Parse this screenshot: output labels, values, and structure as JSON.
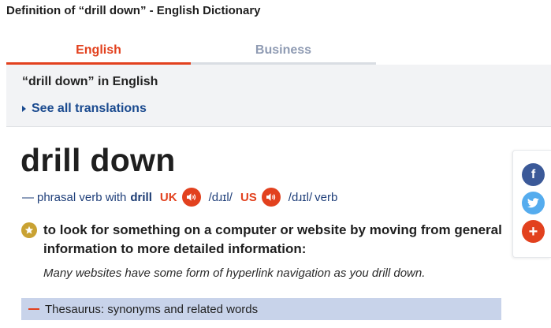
{
  "page": {
    "title": "Definition of “drill down” - English Dictionary"
  },
  "tabs": [
    {
      "label": "English",
      "active": true
    },
    {
      "label": "Business",
      "active": false
    }
  ],
  "translations": {
    "heading": "“drill down” in English",
    "see_all": "See all translations"
  },
  "entry": {
    "headword": "drill down",
    "dash": "—",
    "pos_text": "phrasal verb with",
    "base_word": "drill",
    "uk_label": "UK",
    "uk_ipa": "/dɹɪl/",
    "us_label": "US",
    "us_ipa": "/dɹɪl/",
    "us_pos": "verb",
    "definition": "to look for something on a computer or website by moving from general information to more detailed information:",
    "example": "Many websites have some form of hyperlink navigation as you drill down."
  },
  "thesaurus": {
    "label": "Thesaurus: synonyms and related words"
  },
  "social": {
    "facebook_glyph": "f",
    "plus_glyph": "+"
  },
  "icons": {
    "audio": "speaker-icon",
    "star": "star-icon",
    "caret": "caret-right-icon",
    "facebook": "facebook-icon",
    "twitter": "twitter-icon",
    "plus": "plus-icon"
  },
  "colors": {
    "accent": "#e2411e",
    "link": "#1a4a8f",
    "thesaurus_bg": "#c8d3ea",
    "facebook": "#3b5998",
    "twitter": "#55acee",
    "star": "#c9a233"
  }
}
